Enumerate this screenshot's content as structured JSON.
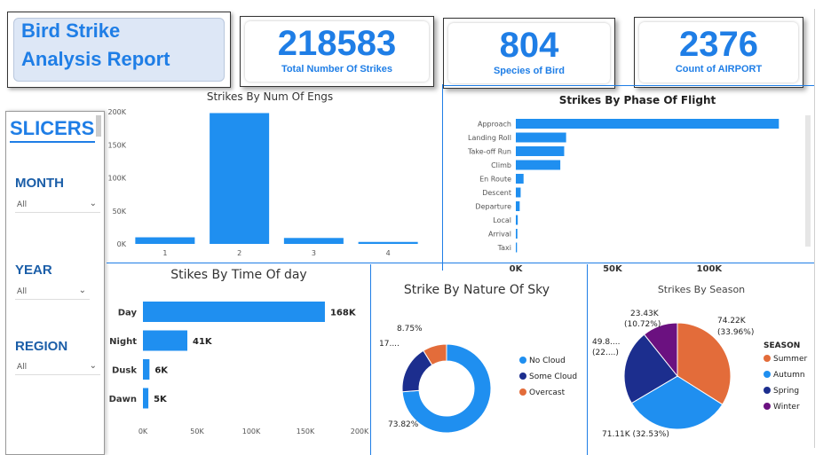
{
  "header": {
    "title_line1": "Bird Strike",
    "title_line2": "Analysis Report"
  },
  "kpis": [
    {
      "value": "218583",
      "label": "Total Number Of Strikes"
    },
    {
      "value": "804",
      "label": "Species of Bird"
    },
    {
      "value": "2376",
      "label": "Count of AIRPORT"
    }
  ],
  "slicers": {
    "title": "SLICERS",
    "items": [
      {
        "label": "MONTH",
        "value": "All"
      },
      {
        "label": "YEAR",
        "value": "All"
      },
      {
        "label": "REGION",
        "value": "All"
      }
    ]
  },
  "colors": {
    "accent": "#1f7ee6",
    "bar": "#1f8ff0",
    "dark_blue": "#1c2e8e",
    "orange": "#e36c3a",
    "purple": "#6b1180"
  },
  "chart_data": [
    {
      "type": "bar",
      "title": "Strikes By Num Of Engs",
      "categories": [
        "1",
        "2",
        "3",
        "4"
      ],
      "values": [
        10000,
        198000,
        9000,
        3000
      ],
      "ylim": [
        0,
        200000
      ],
      "yticks": [
        "0K",
        "50K",
        "100K",
        "150K",
        "200K"
      ],
      "ytick_values": [
        0,
        50000,
        100000,
        150000,
        200000
      ],
      "grid": false
    },
    {
      "type": "bar",
      "orientation": "horizontal",
      "title": "Strikes By Phase Of Flight",
      "categories": [
        "Approach",
        "Landing Roll",
        "Take-off Run",
        "Climb",
        "En Route",
        "Descent",
        "Departure",
        "Local",
        "Arrival",
        "Taxi"
      ],
      "values": [
        136000,
        26000,
        25000,
        23000,
        4000,
        2500,
        2000,
        1000,
        800,
        600
      ],
      "xlim": [
        0,
        140000
      ],
      "xticks": [
        "0K",
        "50K",
        "100K"
      ],
      "xtick_values": [
        0,
        50000,
        100000
      ]
    },
    {
      "type": "bar",
      "orientation": "horizontal",
      "title": "Stikes By Time Of day",
      "categories": [
        "Day",
        "Night",
        "Dusk",
        "Dawn"
      ],
      "values": [
        168000,
        41000,
        6000,
        5000
      ],
      "data_labels": [
        "168K",
        "41K",
        "6K",
        "5K"
      ],
      "xlim": [
        0,
        200000
      ],
      "xticks": [
        "0K",
        "50K",
        "100K",
        "150K",
        "200K"
      ],
      "xtick_values": [
        0,
        50000,
        100000,
        150000,
        200000
      ]
    },
    {
      "type": "pie",
      "variant": "donut",
      "title": "Strike By Nature Of Sky",
      "slices": [
        {
          "name": "No Cloud",
          "percent": 73.82,
          "label": "73.82%",
          "color": "#1f8ff0"
        },
        {
          "name": "Some Cloud",
          "percent": 17.43,
          "label": "17....",
          "color": "#1c2e8e"
        },
        {
          "name": "Overcast",
          "percent": 8.75,
          "label": "8.75%",
          "color": "#e36c3a"
        }
      ],
      "legend": [
        "No Cloud",
        "Some Cloud",
        "Overcast"
      ],
      "legend_position": "right"
    },
    {
      "type": "pie",
      "title": "Strikes By Season",
      "legend_title": "SEASON",
      "slices": [
        {
          "name": "Summer",
          "value": 74220,
          "percent": 33.96,
          "label_1": "74.22K",
          "label_2": "(33.96%)",
          "color": "#e36c3a"
        },
        {
          "name": "Autumn",
          "value": 71110,
          "percent": 32.53,
          "label_1": "71.11K (32.53%)",
          "label_2": "",
          "color": "#1f8ff0"
        },
        {
          "name": "Spring",
          "value": 49800,
          "percent": 22.79,
          "label_1": "49.8....",
          "label_2": "(22....)",
          "color": "#1c2e8e"
        },
        {
          "name": "Winter",
          "value": 23430,
          "percent": 10.72,
          "label_1": "23.43K",
          "label_2": "(10.72%)",
          "color": "#6b1180"
        }
      ],
      "legend": [
        "Summer",
        "Autumn",
        "Spring",
        "Winter"
      ],
      "legend_position": "right"
    }
  ]
}
